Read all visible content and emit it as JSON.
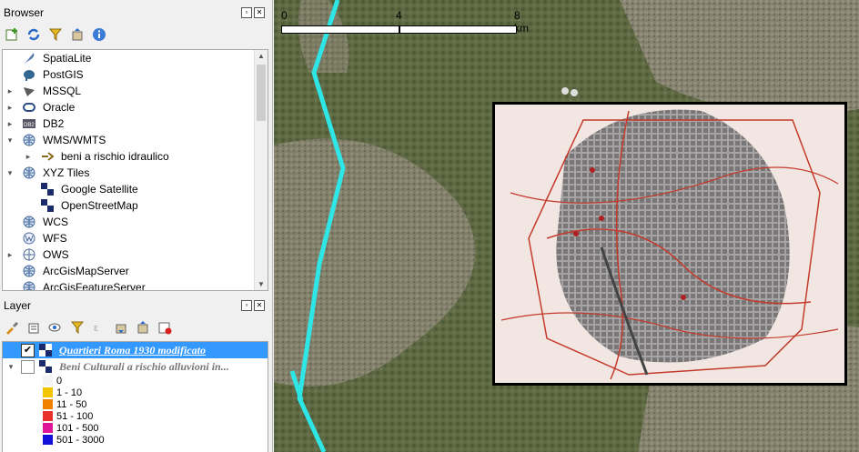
{
  "browser": {
    "title": "Browser",
    "items": [
      {
        "label": "SpatiaLite",
        "icon": "feather-icon",
        "expand": ""
      },
      {
        "label": "PostGIS",
        "icon": "elephant-icon",
        "expand": ""
      },
      {
        "label": "MSSQL",
        "icon": "mssql-icon",
        "expand": "▸"
      },
      {
        "label": "Oracle",
        "icon": "oracle-icon",
        "expand": "▸"
      },
      {
        "label": "DB2",
        "icon": "db2-icon",
        "expand": "▸"
      },
      {
        "label": "WMS/WMTS",
        "icon": "globe-icon",
        "expand": "▾"
      },
      {
        "label": "beni a rischio idraulico",
        "icon": "connection-icon",
        "expand": "▸"
      },
      {
        "label": "XYZ Tiles",
        "icon": "globe-icon",
        "expand": "▾"
      },
      {
        "label": "Google Satellite",
        "icon": "tiles-icon",
        "expand": ""
      },
      {
        "label": "OpenStreetMap",
        "icon": "tiles-icon",
        "expand": ""
      },
      {
        "label": "WCS",
        "icon": "globe-icon",
        "expand": ""
      },
      {
        "label": "WFS",
        "icon": "wfs-icon",
        "expand": ""
      },
      {
        "label": "OWS",
        "icon": "globe-outline-icon",
        "expand": "▸"
      },
      {
        "label": "ArcGisMapServer",
        "icon": "globe-icon",
        "expand": ""
      },
      {
        "label": "ArcGisFeatureServer",
        "icon": "globe-icon",
        "expand": ""
      }
    ]
  },
  "layer": {
    "title": "Layer",
    "layers": [
      {
        "label": "Quartieri Roma 1930 modificato",
        "checked": "✔"
      },
      {
        "label": "Beni Culturali a rischio alluvioni in...",
        "checked": ""
      }
    ],
    "legend": [
      {
        "label": "0",
        "color": "#f4f4f4"
      },
      {
        "label": "1 - 10",
        "color": "#f5c400"
      },
      {
        "label": "11 - 50",
        "color": "#f08000"
      },
      {
        "label": "51 - 100",
        "color": "#e8302c"
      },
      {
        "label": "101 - 500",
        "color": "#e0169a"
      },
      {
        "label": "501 - 3000",
        "color": "#1010d8"
      }
    ]
  },
  "map": {
    "scale_labels": [
      "0",
      "4",
      "8 km"
    ],
    "river_color": "#2ee6e6",
    "overlay_bg": "#f2e6e2",
    "overlay_line": "#c43a2c"
  }
}
